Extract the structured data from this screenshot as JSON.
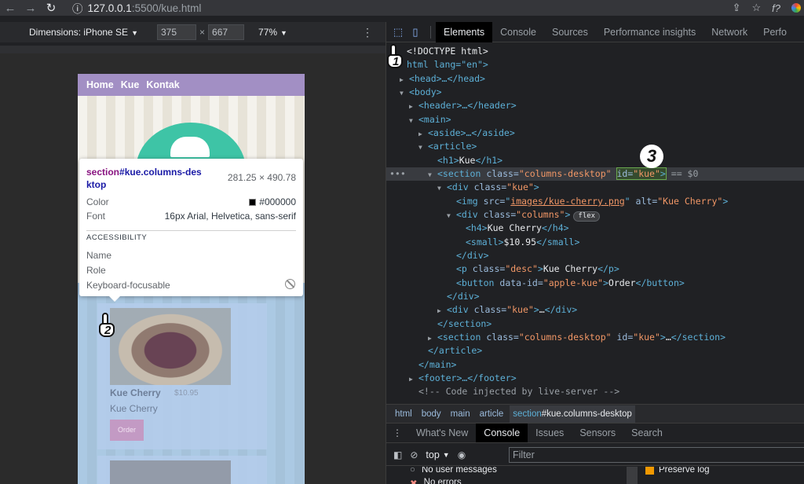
{
  "browser": {
    "url_host": "127.0.0.1",
    "url_path": ":5500/kue.html",
    "back": "←",
    "forward": "→",
    "reload": "↻",
    "info": "ⓘ"
  },
  "device_toolbar": {
    "dimensions_label": "Dimensions: iPhone SE",
    "width": "375",
    "height": "667",
    "times": "×",
    "zoom": "77%"
  },
  "page": {
    "nav": [
      "Home",
      "Kue",
      "Kontak"
    ],
    "card_title": "Kue Cherry",
    "card_price": "$10.95",
    "card_desc": "Kue Cherry",
    "card_button": "Order"
  },
  "tooltip": {
    "tag": "section",
    "selector": "#kue.columns-desktop",
    "size": "281.25 × 490.78",
    "color_label": "Color",
    "color_value": "#000000",
    "font_label": "Font",
    "font_value": "16px Arial, Helvetica, sans-serif",
    "accessibility_heading": "ACCESSIBILITY",
    "name_label": "Name",
    "role_label": "Role",
    "focusable_label": "Keyboard-focusable"
  },
  "markers": {
    "m1": "1",
    "m2": "2",
    "m3": "3"
  },
  "devtools": {
    "tabs": [
      "Elements",
      "Console",
      "Sources",
      "Performance insights",
      "Network",
      "Perfo"
    ],
    "active_tab": "Elements",
    "breadcrumbs": [
      "html",
      "body",
      "main",
      "article"
    ],
    "breadcrumb_last_tag": "section",
    "breadcrumb_last_rest": "#kue.columns-desktop",
    "drawer_tabs": [
      "What's New",
      "Console",
      "Issues",
      "Sensors",
      "Search"
    ],
    "drawer_active": "Console",
    "console_context": "top",
    "filter_placeholder": "Filter",
    "side_items": [
      "No user messages",
      "No errors"
    ],
    "preserve_log": "Preserve log"
  },
  "tree": {
    "doctype": "<!DOCTYPE html>",
    "l1": "html lang=\"en\">",
    "head": "<head>…</head>",
    "body": "<body>",
    "header": "<header>…</header>",
    "main": "<main>",
    "aside": "<aside>…</aside>",
    "article": "<article>",
    "h1_tag1": "<h1>",
    "h1_text": "Kue",
    "h1_tag2": "</h1>",
    "sec_open": "<section ",
    "sec_class_attr": "class=",
    "sec_class_val": "\"columns-desktop\"",
    "sec_id_attr": "id=",
    "sec_id_val": "\"kue\"",
    "sec_eq": "== $0",
    "div_kue": "<div ",
    "div_kue_attr": "class=",
    "div_kue_val": "\"kue\"",
    "img_open": "<img ",
    "img_src_attr": "src=",
    "img_src": "images/kue-cherry.png",
    "img_alt_attr": "alt=",
    "img_alt": "\"Kue Cherry\"",
    "div_columns_val": "\"columns\"",
    "flex_badge": "flex",
    "h4_text": "Kue Cherry",
    "small_text": "$10.95",
    "div_close": "</div>",
    "p_class_val": "\"desc\"",
    "p_text": "Kue Cherry",
    "button_attr": "data-id=",
    "button_val": "\"apple-kue\"",
    "button_text": "Order",
    "div_kue2": "…",
    "section_close": "</section>",
    "article_close": "</article>",
    "main_close": "</main>",
    "footer": "<footer>…</footer>",
    "comment": "<!-- Code injected by live-server -->"
  }
}
